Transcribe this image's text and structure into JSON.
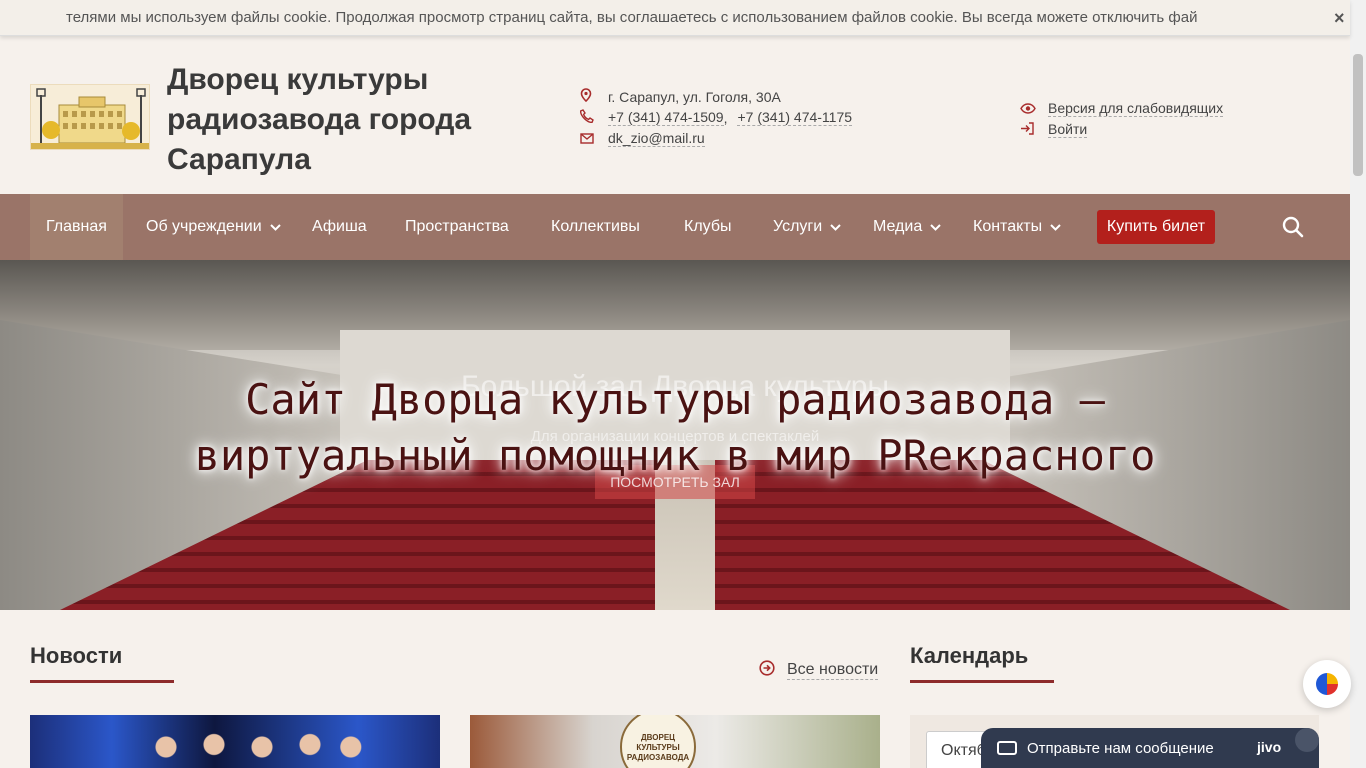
{
  "cookie_bar": {
    "text": "телями мы используем файлы cookie. Продолжая просмотр страниц сайта, вы соглашаетесь с использованием файлов cookie. Вы всегда можете отключить фай",
    "close": "×"
  },
  "header": {
    "title": "Дворец культуры радиозавода города Сарапула",
    "address": "г. Сарапул, ул. Гоголя, 30А",
    "phone1": "+7 (341) 474-1509",
    "phone_sep": ",",
    "phone2": "+7 (341) 474-1175",
    "email": "dk_zio@mail.ru",
    "accessibility_label": "Версия для слабовидящих",
    "login_label": "Войти",
    "icons": {
      "address": "map-pin-icon",
      "phone": "phone-icon",
      "email": "envelope-icon",
      "eye": "eye-icon",
      "login": "login-icon"
    }
  },
  "nav": {
    "items": [
      {
        "label": "Главная",
        "dropdown": false,
        "active": true
      },
      {
        "label": "Об учреждении",
        "dropdown": true
      },
      {
        "label": "Афиша",
        "dropdown": false
      },
      {
        "label": "Пространства",
        "dropdown": false
      },
      {
        "label": "Коллективы",
        "dropdown": false
      },
      {
        "label": "Клубы",
        "dropdown": false
      },
      {
        "label": "Услуги",
        "dropdown": true
      },
      {
        "label": "Медиа",
        "dropdown": true
      },
      {
        "label": "Контакты",
        "dropdown": true
      }
    ],
    "buy_button": "Купить билет",
    "chevron": "⌄"
  },
  "hero": {
    "slide_title": "Большой зал Дворца культуры",
    "slide_subtitle": "Для организации концертов и спектаклей",
    "slide_button": "ПОСМОТРЕТЬ ЗАЛ",
    "overlay_line1": "Сайт Дворца культуры радиозавода –",
    "overlay_line2": "виртуальный помощник в мир PRекрасного"
  },
  "news": {
    "title": "Новости",
    "all_link": "Все новости",
    "card2_badge": "ДВОРЕЦ КУЛЬТУРЫ РАДИОЗАВОДА"
  },
  "calendar": {
    "title": "Календарь",
    "month": "Октябрь"
  },
  "chat": {
    "label": "Отправьте нам сообщение",
    "brand": "jivo"
  },
  "colors": {
    "accent": "#a82c2c",
    "nav_bg": "#9a7468",
    "buy_btn": "#b3201c",
    "page_bg": "#f6f1ec",
    "chat_bg": "#303a4f"
  }
}
